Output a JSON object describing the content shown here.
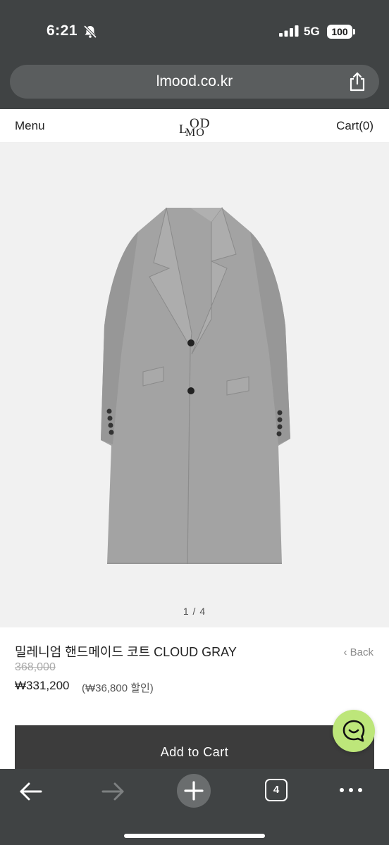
{
  "status_bar": {
    "time": "6:21",
    "network": "5G",
    "battery": "100"
  },
  "browser": {
    "url": "lmood.co.kr",
    "tab_count": "4"
  },
  "header": {
    "menu_label": "Menu",
    "logo_l": "L",
    "logo_od": "OD",
    "logo_mo": "MO",
    "cart_label": "Cart(0)"
  },
  "product": {
    "pager": "1 / 4",
    "title": "밀레니엄 핸드메이드 코트 CLOUD GRAY",
    "back_label": "‹ Back",
    "original_price": "368,000",
    "sale_price": "₩331,200",
    "discount_note": "(₩36,800 할인)",
    "add_to_cart_label": "Add to Cart"
  },
  "colors": {
    "chrome": "#404344",
    "coat": "#a3a3a3",
    "lining": "#3d6b6a",
    "chat_button": "#bde67a"
  },
  "icons": [
    "bell-off-icon",
    "signal-icon",
    "share-icon",
    "back-arrow-icon",
    "forward-arrow-icon",
    "plus-icon",
    "tabs-icon",
    "more-icon",
    "chat-icon"
  ]
}
